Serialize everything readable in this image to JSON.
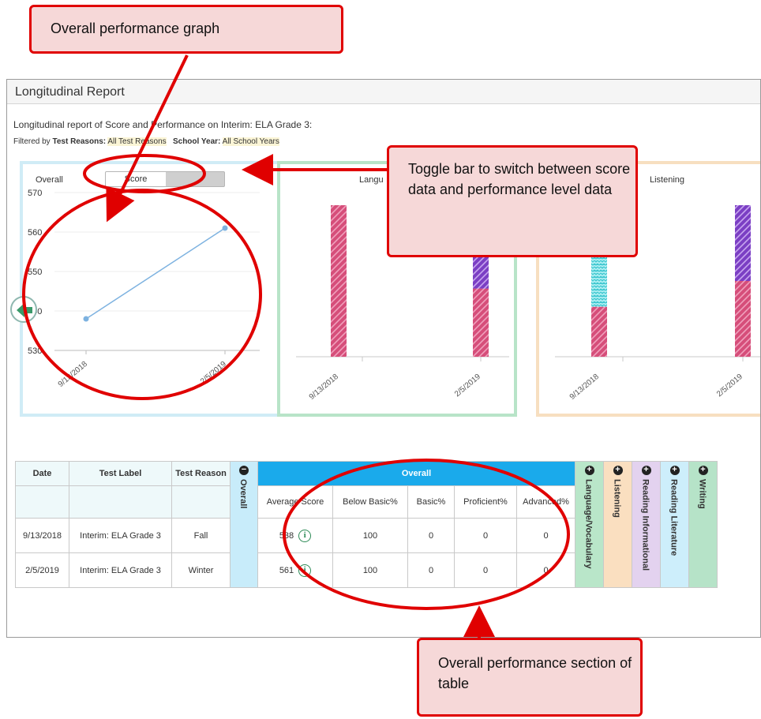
{
  "report": {
    "title": "Longitudinal Report",
    "description": "Longitudinal report of Score and Performance on Interim: ELA Grade 3:",
    "filters": {
      "prefix": "Filtered by",
      "test_reasons_label": "Test Reasons:",
      "test_reasons_value": "All Test Reasons",
      "school_year_label": "School Year:",
      "school_year_value": "All School Years"
    }
  },
  "toggle": {
    "active_label": "Score",
    "inactive_label": ""
  },
  "cards": [
    {
      "title": "Overall",
      "chart_data": {
        "type": "line",
        "x": [
          "9/13/2018",
          "2/5/2019"
        ],
        "series": [
          {
            "values": [
              538,
              561
            ]
          }
        ],
        "yticks": [
          530,
          540,
          550,
          560,
          570
        ],
        "ylim": [
          530,
          570
        ],
        "color": "#7db2e0"
      }
    },
    {
      "title": "Langu",
      "chart_data": {
        "type": "bar",
        "categories": [
          "9/13/2018",
          "2/5/2019"
        ],
        "series": [
          {
            "values": [
              100,
              45
            ]
          },
          {
            "values": [
              0,
              55
            ]
          }
        ],
        "colors": [
          "#d64e7a",
          "#7b3fc4"
        ]
      }
    },
    {
      "title": "Listening",
      "chart_data": {
        "type": "bar",
        "categories": [
          "9/13/2018",
          "2/5/2019"
        ],
        "series": [
          {
            "values": [
              33,
              50
            ]
          },
          {
            "values": [
              0,
              50
            ]
          },
          {
            "values": [
              40,
              0
            ]
          }
        ],
        "colors": [
          "#d64e7a",
          "#7b3fc4",
          "#3fc7d0"
        ]
      }
    }
  ],
  "table": {
    "headers": {
      "date": "Date",
      "test_label": "Test Label",
      "test_reason": "Test Reason",
      "overall_banner": "Overall"
    },
    "overall_columns": [
      "Average Score",
      "Below Basic%",
      "Basic%",
      "Proficient%",
      "Advanced%"
    ],
    "collapsed_sections": [
      "Overall",
      "Language/Vocabulary",
      "Listening",
      "Reading Informational",
      "Reading Literature",
      "Writing"
    ],
    "rows": [
      {
        "date": "9/13/2018",
        "test_label": "Interim: ELA Grade 3",
        "test_reason": "Fall",
        "avg": "538",
        "below_basic": "100",
        "basic": "0",
        "proficient": "0",
        "advanced": "0"
      },
      {
        "date": "2/5/2019",
        "test_label": "Interim: ELA Grade 3",
        "test_reason": "Winter",
        "avg": "561",
        "below_basic": "100",
        "basic": "0",
        "proficient": "0",
        "advanced": "0"
      }
    ]
  },
  "callouts": {
    "graph": "Overall performance graph",
    "toggle": "Toggle bar to switch between score data and performance level data",
    "table": "Overall performance section of table"
  },
  "colors": {
    "annotation_red": "#e00000",
    "banner_blue": "#1aaaeb"
  }
}
